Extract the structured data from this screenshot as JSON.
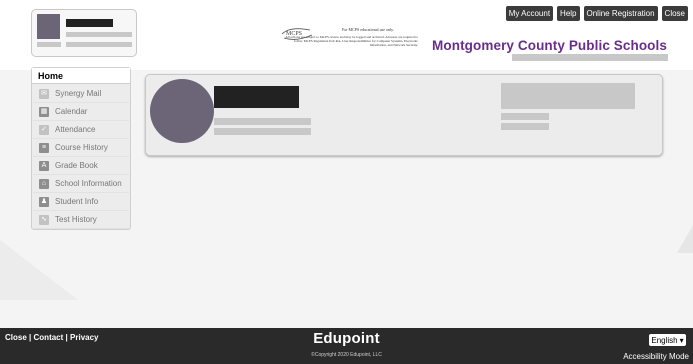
{
  "header": {
    "notice": {
      "logo_text": "MCPS",
      "title": "For MCPS educational use only.",
      "text": "All actions are subject to MCPS review and may be logged and archived. All users are required to follow MCPS Regulation IGT-RA, User Responsibilities for Computer Systems, Electronic Information, and Network Security."
    },
    "buttons": [
      "My Account",
      "Help",
      "Online Registration",
      "Close"
    ],
    "district_name": "Montgomery County Public Schools"
  },
  "nav": {
    "heading": "Home",
    "items": [
      {
        "label": "Synergy Mail",
        "icon": "mail-icon",
        "glyph": "✉"
      },
      {
        "label": "Calendar",
        "icon": "calendar-icon",
        "glyph": "▦"
      },
      {
        "label": "Attendance",
        "icon": "attendance-icon",
        "glyph": "✓"
      },
      {
        "label": "Course History",
        "icon": "course-history-icon",
        "glyph": "≡"
      },
      {
        "label": "Grade Book",
        "icon": "grade-book-icon",
        "glyph": "A"
      },
      {
        "label": "School Information",
        "icon": "school-icon",
        "glyph": "⌂"
      },
      {
        "label": "Student Info",
        "icon": "student-icon",
        "glyph": "♟"
      },
      {
        "label": "Test History",
        "icon": "test-history-icon",
        "glyph": "∿"
      }
    ]
  },
  "footer": {
    "link_close": "Close",
    "link_contact": "Contact",
    "link_privacy": "Privacy",
    "separator": "|",
    "brand": "Edupoint",
    "copyright": "©Copyright 2020 Edupoint, LLC",
    "language": "English",
    "dropdown_arrow": "▾",
    "accessibility": "Accessibility Mode"
  },
  "colors": {
    "accent": "#6a2d8c",
    "footer_bg": "#2a2a2a",
    "button_bg": "#3b3b3b",
    "avatar": "#6b6577"
  }
}
